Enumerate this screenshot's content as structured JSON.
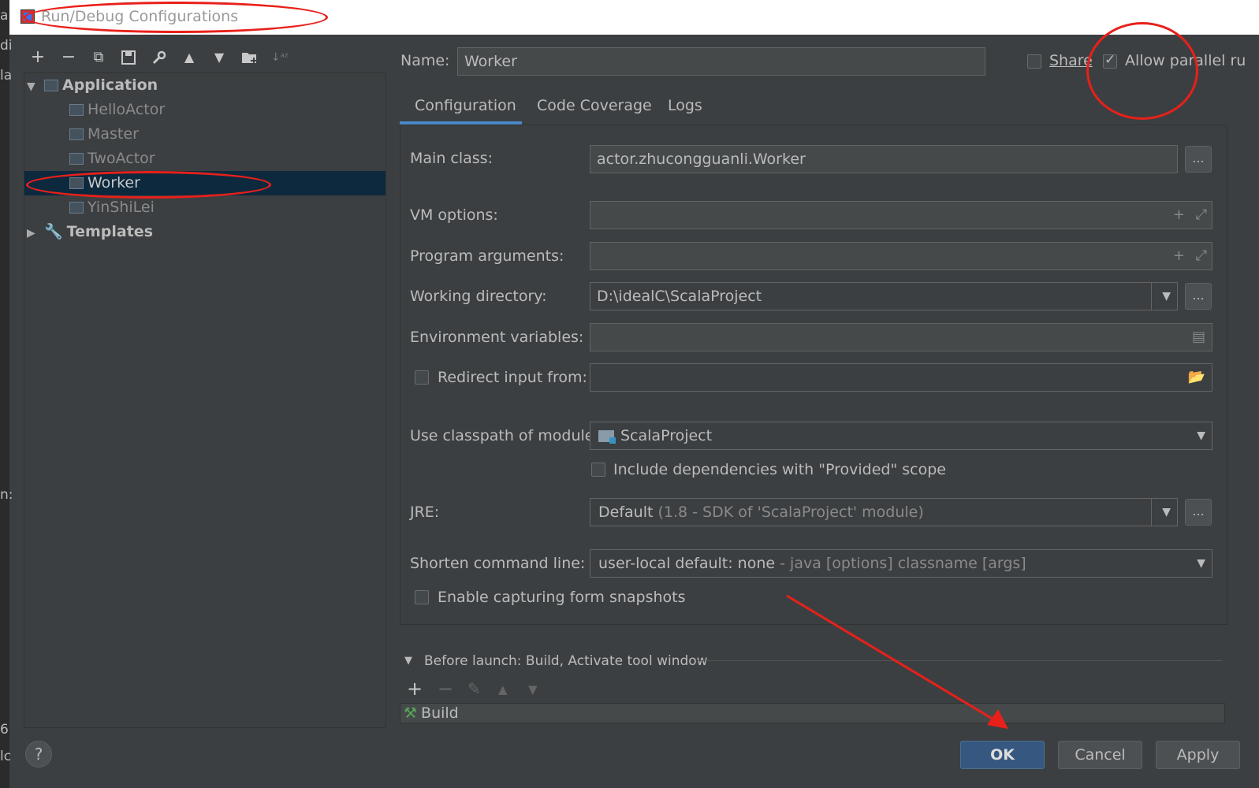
{
  "left_strip": {
    "glyphs": [
      "a",
      "di",
      "la",
      "n:",
      "6",
      "lc"
    ]
  },
  "window": {
    "title": "Run/Debug Configurations"
  },
  "toolbar": {
    "icons": [
      "plus-icon",
      "minus-icon",
      "copy-icon",
      "save-icon",
      "wrench-icon",
      "arrow-up-icon",
      "arrow-down-icon",
      "new-folder-icon",
      "sort-icon"
    ]
  },
  "tree": {
    "application": "Application",
    "items": [
      "HelloActor",
      "Master",
      "TwoActor",
      "Worker",
      "YinShiLei"
    ],
    "selected_index": 3,
    "templates": "Templates"
  },
  "header": {
    "name_label": "Name:",
    "name_value": "Worker",
    "share_label": "Share",
    "share_checked": false,
    "allow_parallel_label": "Allow parallel ru",
    "allow_parallel_checked": true
  },
  "tabs": [
    "Configuration",
    "Code Coverage",
    "Logs"
  ],
  "active_tab": "Configuration",
  "form": {
    "main_class_label": "Main class:",
    "main_class_value": "actor.zhucongguanli.Worker",
    "vm_options_label": "VM options:",
    "vm_options_value": "",
    "program_args_label": "Program arguments:",
    "program_args_value": "",
    "working_dir_label": "Working directory:",
    "working_dir_value": "D:\\idealC\\ScalaProject",
    "env_vars_label": "Environment variables:",
    "env_vars_value": "",
    "redirect_label": "Redirect input from:",
    "redirect_checked": false,
    "classpath_label": "Use classpath of module:",
    "classpath_value": "ScalaProject",
    "include_deps_label": "Include dependencies with \"Provided\" scope",
    "include_deps_checked": false,
    "jre_label": "JRE:",
    "jre_value": "Default",
    "jre_hint": "(1.8 - SDK of 'ScalaProject' module)",
    "shorten_label": "Shorten command line:",
    "shorten_value": "user-local default: none",
    "shorten_hint": "- java [options] classname [args]",
    "capture_label": "Enable capturing form snapshots",
    "capture_checked": false,
    "browse_label": "..."
  },
  "before_launch": {
    "title": "Before launch: Build, Activate tool window",
    "items": [
      "Build"
    ]
  },
  "buttons": {
    "help": "?",
    "ok": "OK",
    "cancel": "Cancel",
    "apply": "Apply"
  },
  "colors": {
    "background": "#3c3f41",
    "selection": "#0d293e",
    "accent": "#4a88c7",
    "ok_button": "#365880",
    "annotation": "#e8201a"
  }
}
